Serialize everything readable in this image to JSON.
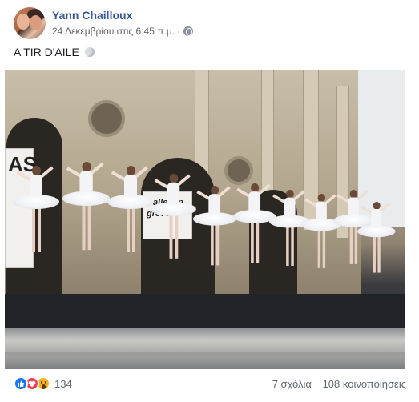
{
  "post": {
    "author": "Yann Chailloux",
    "timestamp": "24 Δεκεμβρίου στις 6:45 π.μ.",
    "separator": "·",
    "privacy_icon": "globe-icon",
    "caption": "A TIR D'AILE",
    "caption_emoji": "crescent-moon-icon",
    "photo_banner_left": "AS",
    "photo_banner_right": "Ballet en grève"
  },
  "footer": {
    "reaction_icons": [
      "like-icon",
      "love-icon",
      "wow-icon"
    ],
    "reaction_count": "134",
    "comments": "7 σχόλια",
    "shares": "108 κοινοποιήσεις"
  },
  "colors": {
    "author_link": "#385898",
    "meta_text": "#616770",
    "like": "#1877f2",
    "love": "#f33e58",
    "wow": "#f7b125"
  }
}
